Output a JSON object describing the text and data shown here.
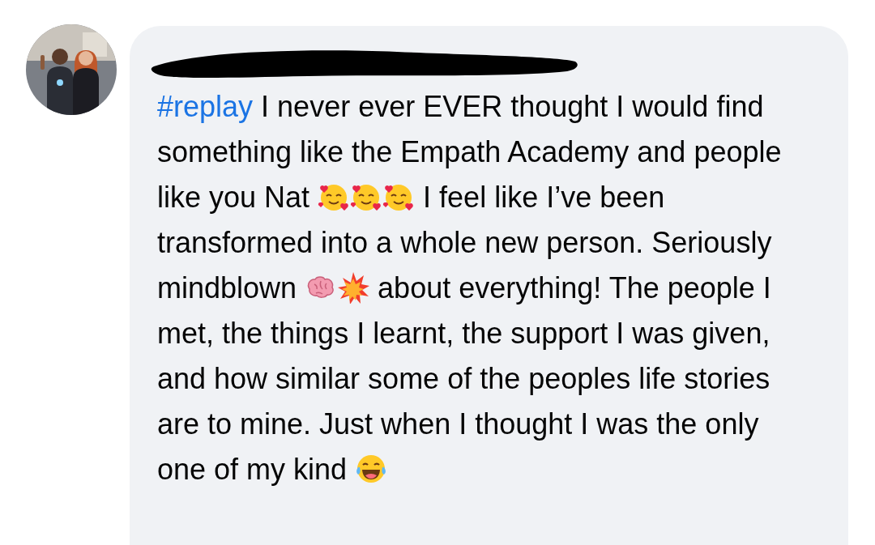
{
  "comment": {
    "author": {
      "redacted": true
    },
    "message": [
      {
        "kind": "hashtag",
        "text": "#replay"
      },
      {
        "kind": "text",
        "text": " I never ever EVER thought I would find something like the Empath Academy and people like you Nat "
      },
      {
        "kind": "hearts"
      },
      {
        "kind": "hearts"
      },
      {
        "kind": "hearts"
      },
      {
        "kind": "text",
        "text": " I feel like I’ve been transformed into a whole new person. Seriously mindblown "
      },
      {
        "kind": "brain"
      },
      {
        "kind": "collision"
      },
      {
        "kind": "text",
        "text": " about everything! The people I met, the things I learnt, the support I was given, and how similar some of the peoples life stories are to mine. Just when I thought I was the only one of my kind "
      },
      {
        "kind": "laughing"
      }
    ]
  }
}
